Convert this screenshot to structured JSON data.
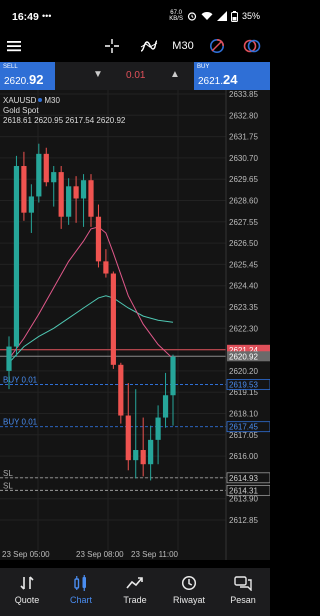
{
  "status_bar": {
    "time": "16:49",
    "network_speed_value": "67.0",
    "network_speed_unit": "KB/S",
    "battery": "35%"
  },
  "toolbar": {
    "menu_icon": "hamburger-icon",
    "crosshair_icon": "crosshair-icon",
    "indicators_icon": "indicator-icon",
    "timeframe": "M30",
    "objects_icon": "objects-icon",
    "trade_icon": "trade-icon"
  },
  "quote_bar": {
    "sell_label": "SELL",
    "sell_price_main": "2620.",
    "sell_price_big": "92",
    "lot": "0.01",
    "buy_label": "BUY",
    "buy_price_main": "2621.",
    "buy_price_big": "24"
  },
  "chart_header": {
    "symbol": "XAUUSD",
    "timeframe": "M30",
    "description": "Gold Spot",
    "ohlc": "2618.61 2620.95 2617.54 2620.92"
  },
  "chart_data": {
    "type": "candlestick",
    "symbol": "XAUUSD",
    "timeframe": "M30",
    "y_ticks": [
      "2633.85",
      "2632.80",
      "2631.75",
      "2630.70",
      "2629.65",
      "2628.60",
      "2627.55",
      "2626.50",
      "2625.45",
      "2624.40",
      "2623.35",
      "2622.30",
      "2621.25",
      "2620.20",
      "2619.15",
      "2618.10",
      "2617.05",
      "2616.00",
      "2614.95",
      "2613.90",
      "2612.85"
    ],
    "x_ticks": [
      "23 Sep 05:00",
      "23 Sep 08:00",
      "23 Sep 11:00"
    ],
    "candles": [
      {
        "o": 2620.2,
        "h": 2621.9,
        "l": 2619.3,
        "c": 2621.4
      },
      {
        "o": 2621.4,
        "h": 2630.8,
        "l": 2620.9,
        "c": 2630.3
      },
      {
        "o": 2630.3,
        "h": 2631.0,
        "l": 2627.6,
        "c": 2628.0
      },
      {
        "o": 2628.0,
        "h": 2629.4,
        "l": 2627.0,
        "c": 2628.8
      },
      {
        "o": 2628.8,
        "h": 2631.4,
        "l": 2628.5,
        "c": 2630.9
      },
      {
        "o": 2630.9,
        "h": 2631.2,
        "l": 2629.3,
        "c": 2629.5
      },
      {
        "o": 2629.5,
        "h": 2630.3,
        "l": 2628.3,
        "c": 2630.0
      },
      {
        "o": 2630.0,
        "h": 2630.3,
        "l": 2627.2,
        "c": 2627.8
      },
      {
        "o": 2627.8,
        "h": 2629.7,
        "l": 2627.4,
        "c": 2629.3
      },
      {
        "o": 2629.3,
        "h": 2629.8,
        "l": 2627.5,
        "c": 2628.7
      },
      {
        "o": 2628.7,
        "h": 2629.9,
        "l": 2627.3,
        "c": 2629.6
      },
      {
        "o": 2629.6,
        "h": 2629.9,
        "l": 2627.3,
        "c": 2627.8
      },
      {
        "o": 2627.8,
        "h": 2628.4,
        "l": 2625.3,
        "c": 2625.6
      },
      {
        "o": 2625.6,
        "h": 2626.2,
        "l": 2624.8,
        "c": 2625.0
      },
      {
        "o": 2625.0,
        "h": 2625.1,
        "l": 2620.3,
        "c": 2620.5
      },
      {
        "o": 2620.5,
        "h": 2620.6,
        "l": 2617.6,
        "c": 2618.0
      },
      {
        "o": 2618.0,
        "h": 2619.6,
        "l": 2615.3,
        "c": 2615.8
      },
      {
        "o": 2615.8,
        "h": 2619.3,
        "l": 2614.9,
        "c": 2616.3
      },
      {
        "o": 2616.3,
        "h": 2617.9,
        "l": 2615.0,
        "c": 2615.6
      },
      {
        "o": 2615.6,
        "h": 2617.5,
        "l": 2614.8,
        "c": 2616.8
      },
      {
        "o": 2616.8,
        "h": 2618.5,
        "l": 2615.6,
        "c": 2617.9
      },
      {
        "o": 2617.9,
        "h": 2620.1,
        "l": 2617.4,
        "c": 2619.0
      },
      {
        "o": 2619.0,
        "h": 2621.0,
        "l": 2617.5,
        "c": 2620.9
      }
    ],
    "ma_fast": [
      {
        "i": 0,
        "v": 2620.8
      },
      {
        "i": 2,
        "v": 2621.8
      },
      {
        "i": 4,
        "v": 2623.0
      },
      {
        "i": 6,
        "v": 2624.3
      },
      {
        "i": 8,
        "v": 2625.6
      },
      {
        "i": 10,
        "v": 2626.6
      },
      {
        "i": 11,
        "v": 2627.2
      },
      {
        "i": 12,
        "v": 2627.3
      },
      {
        "i": 13,
        "v": 2627.0
      },
      {
        "i": 14,
        "v": 2626.0
      },
      {
        "i": 16,
        "v": 2623.9
      },
      {
        "i": 18,
        "v": 2622.5
      },
      {
        "i": 20,
        "v": 2621.5
      },
      {
        "i": 22,
        "v": 2620.8
      }
    ],
    "ma_slow": [
      {
        "i": 0,
        "v": 2620.6
      },
      {
        "i": 2,
        "v": 2621.4
      },
      {
        "i": 4,
        "v": 2621.9
      },
      {
        "i": 6,
        "v": 2622.3
      },
      {
        "i": 8,
        "v": 2622.8
      },
      {
        "i": 10,
        "v": 2623.3
      },
      {
        "i": 12,
        "v": 2623.8
      },
      {
        "i": 13,
        "v": 2623.9
      },
      {
        "i": 14,
        "v": 2623.8
      },
      {
        "i": 16,
        "v": 2623.3
      },
      {
        "i": 18,
        "v": 2622.9
      },
      {
        "i": 20,
        "v": 2622.7
      },
      {
        "i": 22,
        "v": 2622.6
      }
    ],
    "levels": [
      {
        "label": "",
        "price": "2621.24",
        "kind": "ask",
        "color": "#e0505a"
      },
      {
        "label": "",
        "price": "2620.92",
        "kind": "bid",
        "color": "#8a8a8a"
      },
      {
        "label": "BUY 0.01",
        "price": "2619.53",
        "kind": "order",
        "color": "#2f6fd6"
      },
      {
        "label": "BUY 0.01",
        "price": "2617.45",
        "kind": "order",
        "color": "#2f6fd6"
      },
      {
        "label": "SL",
        "price": "2614.93",
        "kind": "sl",
        "color": "#9a9a9a"
      },
      {
        "label": "SL",
        "price": "2614.31",
        "kind": "sl",
        "color": "#9a9a9a"
      }
    ],
    "colors": {
      "up": "#26a69a",
      "down": "#ef5350",
      "ma_fast": "#e0588a",
      "ma_slow": "#4fc7b3"
    }
  },
  "bottom_nav": {
    "items": [
      {
        "label": "Quote",
        "icon": "quote-icon",
        "active": false
      },
      {
        "label": "Chart",
        "icon": "chart-icon",
        "active": true
      },
      {
        "label": "Trade",
        "icon": "trade-icon",
        "active": false
      },
      {
        "label": "Riwayat",
        "icon": "history-icon",
        "active": false
      },
      {
        "label": "Pesan",
        "icon": "messages-icon",
        "active": false
      }
    ]
  }
}
